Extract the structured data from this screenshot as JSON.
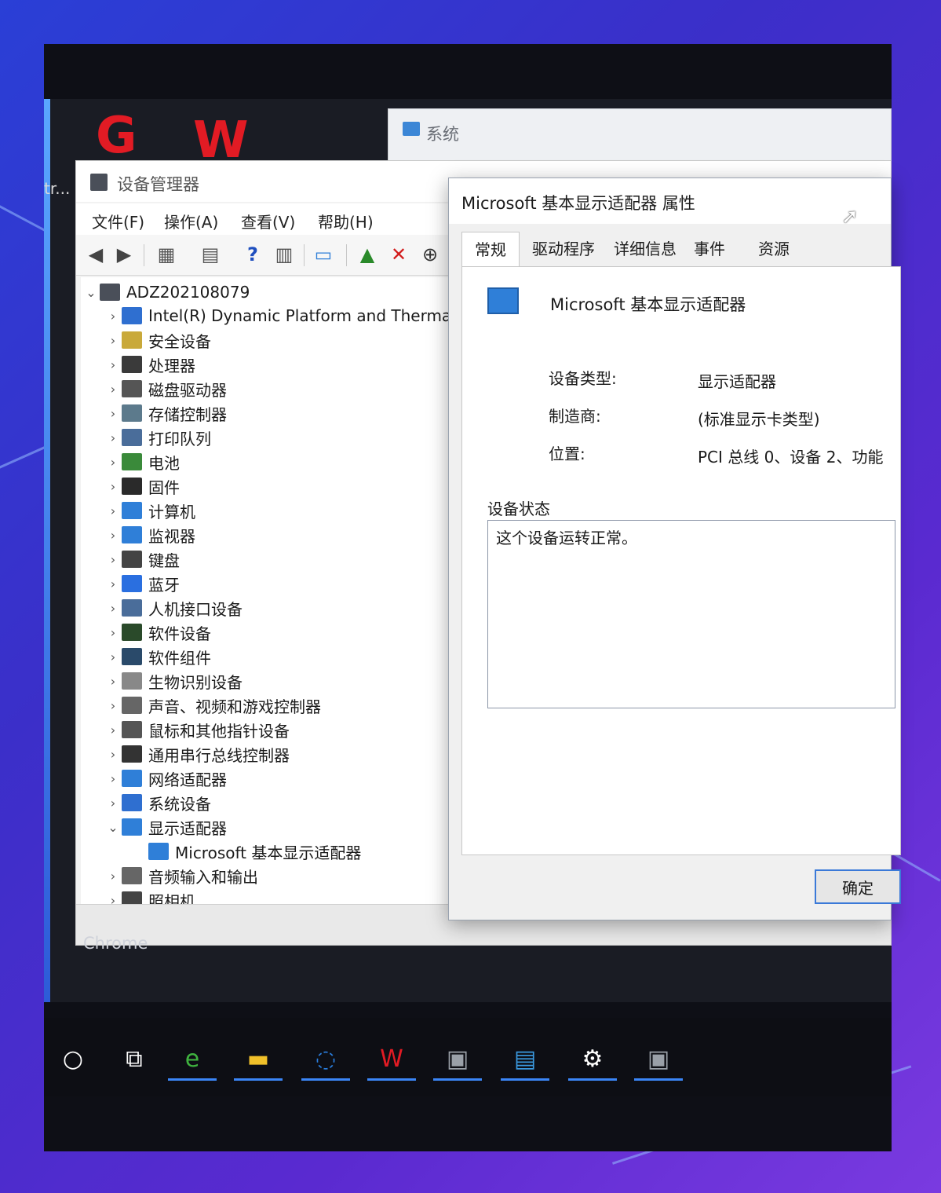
{
  "system_window": {
    "title": "系统"
  },
  "desktop": {
    "left_label": "tr...",
    "chrome_label": "Chrome"
  },
  "device_manager": {
    "title": "设备管理器",
    "menu": [
      "文件(F)",
      "操作(A)",
      "查看(V)",
      "帮助(H)"
    ],
    "toolbar_icons": [
      "back-arrow-icon",
      "forward-arrow-icon",
      "properties-grid-icon",
      "document-icon",
      "help-icon",
      "view-panel-icon",
      "monitor-scan-icon",
      "update-driver-icon",
      "remove-device-icon",
      "download-icon"
    ],
    "tree": {
      "root": "ADZ202108079",
      "items": [
        {
          "label": "Intel(R) Dynamic Platform and Thermal F",
          "icon": "folder-blue-icon",
          "color": "#2f6fd0"
        },
        {
          "label": "安全设备",
          "icon": "security-key-icon",
          "color": "#c9a93a"
        },
        {
          "label": "处理器",
          "icon": "cpu-icon",
          "color": "#3a3a3a"
        },
        {
          "label": "磁盘驱动器",
          "icon": "disk-icon",
          "color": "#555"
        },
        {
          "label": "存储控制器",
          "icon": "storage-icon",
          "color": "#5c7a8c"
        },
        {
          "label": "打印队列",
          "icon": "printer-icon",
          "color": "#4a6d9a"
        },
        {
          "label": "电池",
          "icon": "battery-icon",
          "color": "#3a8a3a"
        },
        {
          "label": "固件",
          "icon": "firmware-icon",
          "color": "#2a2a2a"
        },
        {
          "label": "计算机",
          "icon": "computer-icon",
          "color": "#2f7fd8"
        },
        {
          "label": "监视器",
          "icon": "monitor-icon",
          "color": "#2f7fd8"
        },
        {
          "label": "键盘",
          "icon": "keyboard-icon",
          "color": "#444"
        },
        {
          "label": "蓝牙",
          "icon": "bluetooth-icon",
          "color": "#2a6fe0"
        },
        {
          "label": "人机接口设备",
          "icon": "hid-icon",
          "color": "#4a6d9a"
        },
        {
          "label": "软件设备",
          "icon": "software-device-icon",
          "color": "#2a4a2a"
        },
        {
          "label": "软件组件",
          "icon": "software-component-icon",
          "color": "#2a4a6a"
        },
        {
          "label": "生物识别设备",
          "icon": "biometric-icon",
          "color": "#888"
        },
        {
          "label": "声音、视频和游戏控制器",
          "icon": "speaker-icon",
          "color": "#666"
        },
        {
          "label": "鼠标和其他指针设备",
          "icon": "mouse-icon",
          "color": "#555"
        },
        {
          "label": "通用串行总线控制器",
          "icon": "usb-icon",
          "color": "#333"
        },
        {
          "label": "网络适配器",
          "icon": "network-icon",
          "color": "#2f7fd8"
        },
        {
          "label": "系统设备",
          "icon": "system-device-icon",
          "color": "#2f6fd0"
        },
        {
          "label": "显示适配器",
          "icon": "display-adapter-icon",
          "color": "#2f7fd8",
          "expanded": true
        },
        {
          "label": "Microsoft 基本显示适配器",
          "icon": "display-adapter-icon",
          "color": "#2f7fd8",
          "child": true
        },
        {
          "label": "音频输入和输出",
          "icon": "audio-icon",
          "color": "#666"
        },
        {
          "label": "照相机",
          "icon": "camera-icon",
          "color": "#444"
        }
      ]
    }
  },
  "properties": {
    "title": "Microsoft 基本显示适配器 属性",
    "tabs": [
      "常规",
      "驱动程序",
      "详细信息",
      "事件",
      "资源"
    ],
    "device_name": "Microsoft 基本显示适配器",
    "fields": [
      {
        "key": "设备类型:",
        "value": "显示适配器"
      },
      {
        "key": "制造商:",
        "value": "(标准显示卡类型)"
      },
      {
        "key": "位置:",
        "value": "PCI 总线 0、设备 2、功能"
      }
    ],
    "status_label": "设备状态",
    "status_text": "这个设备运转正常。",
    "ok_label": "确定"
  },
  "taskbar": {
    "items": [
      {
        "icon": "search-circle-icon",
        "glyph": "○",
        "color": "#ffffff",
        "active": false
      },
      {
        "icon": "task-view-icon",
        "glyph": "⧉",
        "color": "#ffffff",
        "active": false
      },
      {
        "icon": "browser-icon",
        "glyph": "e",
        "color": "#3fb23f",
        "active": true
      },
      {
        "icon": "file-explorer-icon",
        "glyph": "▬",
        "color": "#f0c02a",
        "active": true
      },
      {
        "icon": "chat-icon",
        "glyph": "◌",
        "color": "#2a7fe0",
        "active": true
      },
      {
        "icon": "wps-icon",
        "glyph": "W",
        "color": "#e21b24",
        "active": true
      },
      {
        "icon": "device-manager-icon",
        "glyph": "▣",
        "color": "#9aa0a8",
        "active": true
      },
      {
        "icon": "control-panel-icon",
        "glyph": "▤",
        "color": "#3b9ae0",
        "active": true
      },
      {
        "icon": "settings-gear-icon",
        "glyph": "⚙",
        "color": "#ffffff",
        "active": true
      },
      {
        "icon": "device-manager-icon",
        "glyph": "▣",
        "color": "#9aa0a8",
        "active": true
      }
    ]
  },
  "colors": {
    "accent": "#3b86f7",
    "wps_red": "#e21b24"
  }
}
